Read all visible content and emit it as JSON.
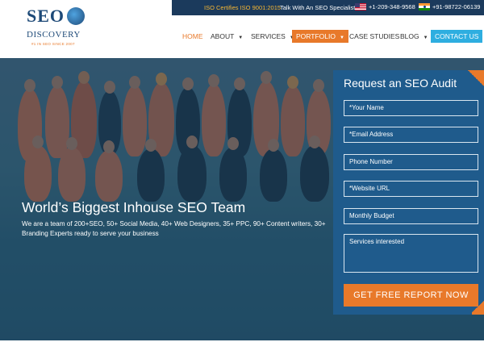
{
  "topbar": {
    "iso": "ISO Certifies ISO 9001:2015",
    "talk": "Talk With An SEO Specialist:",
    "phone_us": "+1-209-348-9568",
    "phone_in": "+91-98722-06139"
  },
  "logo": {
    "line1": "SEO",
    "line2": "DISCOVERY",
    "tagline": "#1 IN SEO SINCE 2007"
  },
  "nav": {
    "home": "HOME",
    "about": "ABOUT",
    "services": "SERVICES",
    "portfolio": "PORTFOLIO",
    "case_studies": "CASE STUDIES",
    "blog": "BLOG",
    "contact": "CONTACT US"
  },
  "hero": {
    "title": "World’s Biggest Inhouse SEO Team",
    "description": "We are a team of 200+SEO, 50+ Social Media, 40+ Web Designers, 35+ PPC, 90+ Content writers, 30+ Branding Experts ready to serve your business"
  },
  "form": {
    "title": "Request an SEO Audit",
    "name_placeholder": "*Your Name",
    "email_placeholder": "*Email Address",
    "phone_placeholder": "Phone Number",
    "website_placeholder": "*Website URL",
    "budget_placeholder": "Monthly Budget",
    "services_placeholder": "Services interested",
    "submit": "GET FREE REPORT NOW"
  },
  "colors": {
    "accent_orange": "#e8792a",
    "navy": "#1b3a5c",
    "form_blue": "#1f5b8c",
    "contact_blue": "#2eaee0"
  }
}
